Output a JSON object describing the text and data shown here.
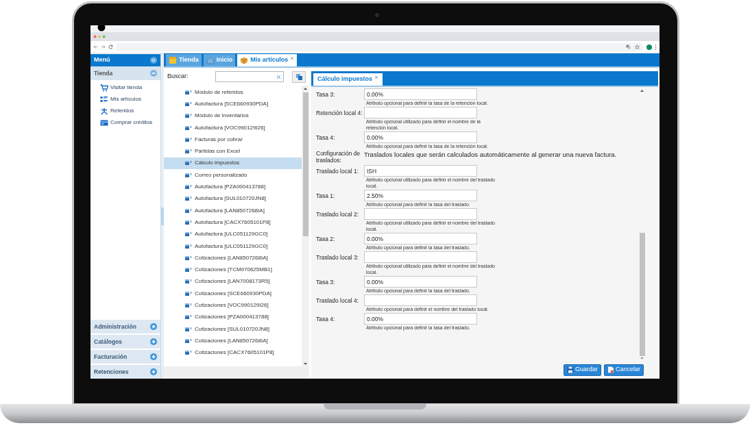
{
  "menu": {
    "title": "Menú",
    "sections": [
      {
        "label": "Tienda",
        "expanded": true,
        "items": [
          "Visitar tienda",
          "Mis artículos",
          "Referidos",
          "Comprar créditos"
        ]
      },
      {
        "label": "Administración",
        "expanded": false
      },
      {
        "label": "Catálogos",
        "expanded": false
      },
      {
        "label": "Facturación",
        "expanded": false
      },
      {
        "label": "Retenciones",
        "expanded": false
      }
    ]
  },
  "tabs": [
    {
      "label": "Tienda",
      "selected": false
    },
    {
      "label": "Inicio",
      "selected": false
    },
    {
      "label": "Mis artículos",
      "selected": true
    }
  ],
  "search": {
    "label": "Buscar:"
  },
  "tree": [
    {
      "label": "Módulo de referidos",
      "selected": false
    },
    {
      "label": "Autofactura [SCE660930PDA]",
      "selected": false
    },
    {
      "label": "Módulo de Inventarios",
      "selected": false
    },
    {
      "label": "Autofactura [VOC990129I26]",
      "selected": false
    },
    {
      "label": "Facturas por cobrar",
      "selected": false
    },
    {
      "label": "Partidas con Excel",
      "selected": false
    },
    {
      "label": "Cálculo impuestos",
      "selected": true
    },
    {
      "label": "Correo personalizado",
      "selected": false
    },
    {
      "label": "Autofactura [PZA000413788]",
      "selected": false
    },
    {
      "label": "Autofactura [SUL010720JN8]",
      "selected": false
    },
    {
      "label": "Autofactura [LAN8507268IA]",
      "selected": false
    },
    {
      "label": "Autofactura [CACX7605101P8]",
      "selected": false
    },
    {
      "label": "Autofactura [ULC051129GC0]",
      "selected": false
    },
    {
      "label": "Autofactura [ULC051129GC0]",
      "selected": false
    },
    {
      "label": "Cotizaciones [LAN8507268IA]",
      "selected": false
    },
    {
      "label": "Cotizaciones [TCM970625MB1]",
      "selected": false
    },
    {
      "label": "Cotizaciones [LAN7008173R5]",
      "selected": false
    },
    {
      "label": "Cotizaciones [SCE660930PDA]",
      "selected": false
    },
    {
      "label": "Cotizaciones [VOC990129I26]",
      "selected": false
    },
    {
      "label": "Cotizaciones [PZA000413788]",
      "selected": false
    },
    {
      "label": "Cotizaciones [SUL010720JN8]",
      "selected": false
    },
    {
      "label": "Cotizaciones [LAN8507268IA]",
      "selected": false
    },
    {
      "label": "Cotizaciones [CACX7605101P8]",
      "selected": false
    }
  ],
  "detail_tab": {
    "label": "Cálculo impuestos"
  },
  "form": [
    {
      "kind": "field",
      "label": "Tasa 3:",
      "value": "0.00%",
      "help": "Atributo opcional para definir la tasa de la retención local."
    },
    {
      "kind": "field",
      "label": "Retención local 4:",
      "help": "Atributo opcional utilizado para definir el nombre de la retención local."
    },
    {
      "kind": "field",
      "label": "Tasa 4:",
      "value": "0.00%",
      "help": "Atributo opcional para definir la tasa de la retención local."
    },
    {
      "kind": "info",
      "label": "Configuración de traslados:",
      "text": "Traslados locales que serán calculados automáticamente al generar una nueva factura."
    },
    {
      "kind": "field",
      "label": "Traslado local 1:",
      "value": "ISH",
      "help": "Atributo opcional utilizado para definir el nombre del traslado local."
    },
    {
      "kind": "field",
      "label": "Tasa 1:",
      "value": "2.50%",
      "help": "Atributo opcional para definir la tasa del traslado."
    },
    {
      "kind": "field",
      "label": "Traslado local 2:",
      "help": "Atributo opcional utilizado para definir el nombre del traslado local."
    },
    {
      "kind": "field",
      "label": "Tasa 2:",
      "value": "0.00%",
      "help": "Atributo opcional para definir la tasa del traslado."
    },
    {
      "kind": "field",
      "label": "Traslado local 3:",
      "help": "Atributo opcional utilizado para definir el nombre del traslado local."
    },
    {
      "kind": "field",
      "label": "Tasa 3:",
      "value": "0.00%",
      "help": "Atributo opcional para definir la tasa del traslado."
    },
    {
      "kind": "field",
      "label": "Traslado local 4:",
      "help": "Atributo opcional para definir el nombre del traslado local."
    },
    {
      "kind": "field",
      "label": "Tasa 4:",
      "value": "0.00%",
      "help": "Atributo opcional para definir la tasa del traslado."
    }
  ],
  "buttons": [
    "Guardar",
    "Cancelar"
  ]
}
